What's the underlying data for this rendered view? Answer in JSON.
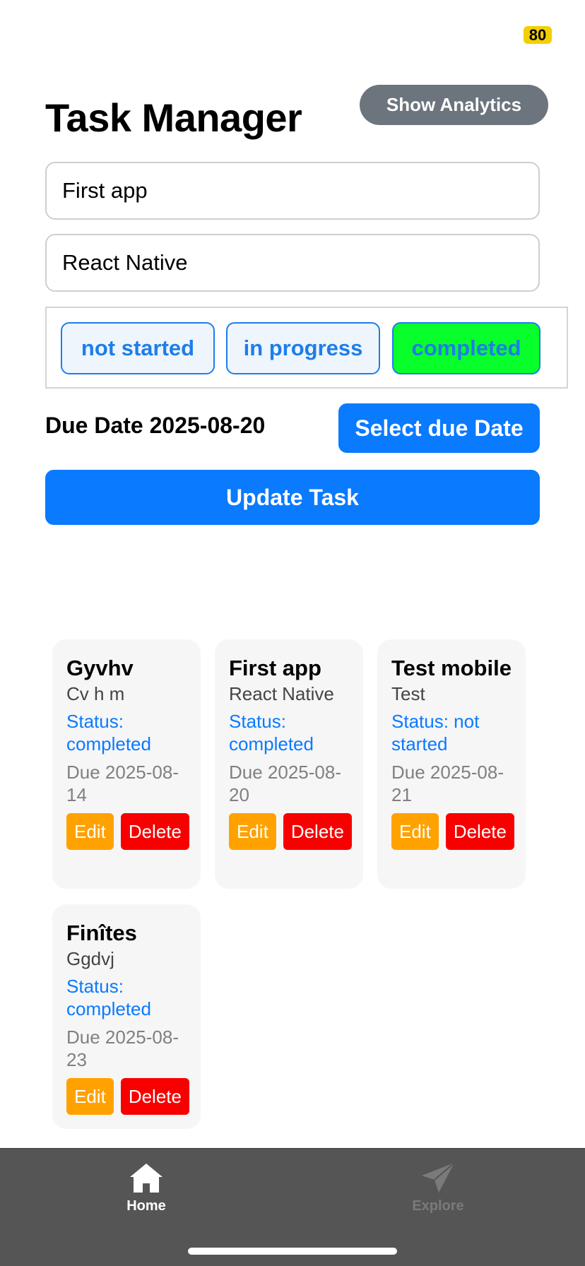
{
  "status_bar": {
    "battery": "80"
  },
  "header": {
    "title": "Task Manager",
    "analytics_button": "Show Analytics"
  },
  "form": {
    "title_value": "First app",
    "description_value": "React Native",
    "status_options": [
      "not started",
      "in progress",
      "completed"
    ],
    "selected_status": "completed",
    "due_label": "Due Date 2025-08-20",
    "select_due_button": "Select due Date",
    "update_button": "Update Task"
  },
  "tasks": [
    {
      "title": "Gyvhv",
      "description": "Cv h m",
      "status": "Status: completed",
      "due": "Due 2025-08-14",
      "edit": "Edit",
      "delete": "Delete"
    },
    {
      "title": "First app",
      "description": "React Native",
      "status": "Status: completed",
      "due": "Due 2025-08-20",
      "edit": "Edit",
      "delete": "Delete"
    },
    {
      "title": "Test mobile",
      "description": "Test",
      "status": "Status: not started",
      "due": "Due 2025-08-21",
      "edit": "Edit",
      "delete": "Delete"
    },
    {
      "title": "Finîtes",
      "description": "Ggdvj",
      "status": "Status: completed",
      "due": "Due 2025-08-23",
      "edit": "Edit",
      "delete": "Delete"
    }
  ],
  "tab_bar": {
    "home": {
      "label": "Home",
      "icon": "home-icon",
      "active": true
    },
    "explore": {
      "label": "Explore",
      "icon": "paper-plane-icon",
      "active": false
    }
  },
  "colors": {
    "primary": "#0a7aff",
    "selected_status": "#08ff2c",
    "edit": "#ffa200",
    "delete": "#f80000",
    "analytics": "#6c757d"
  }
}
